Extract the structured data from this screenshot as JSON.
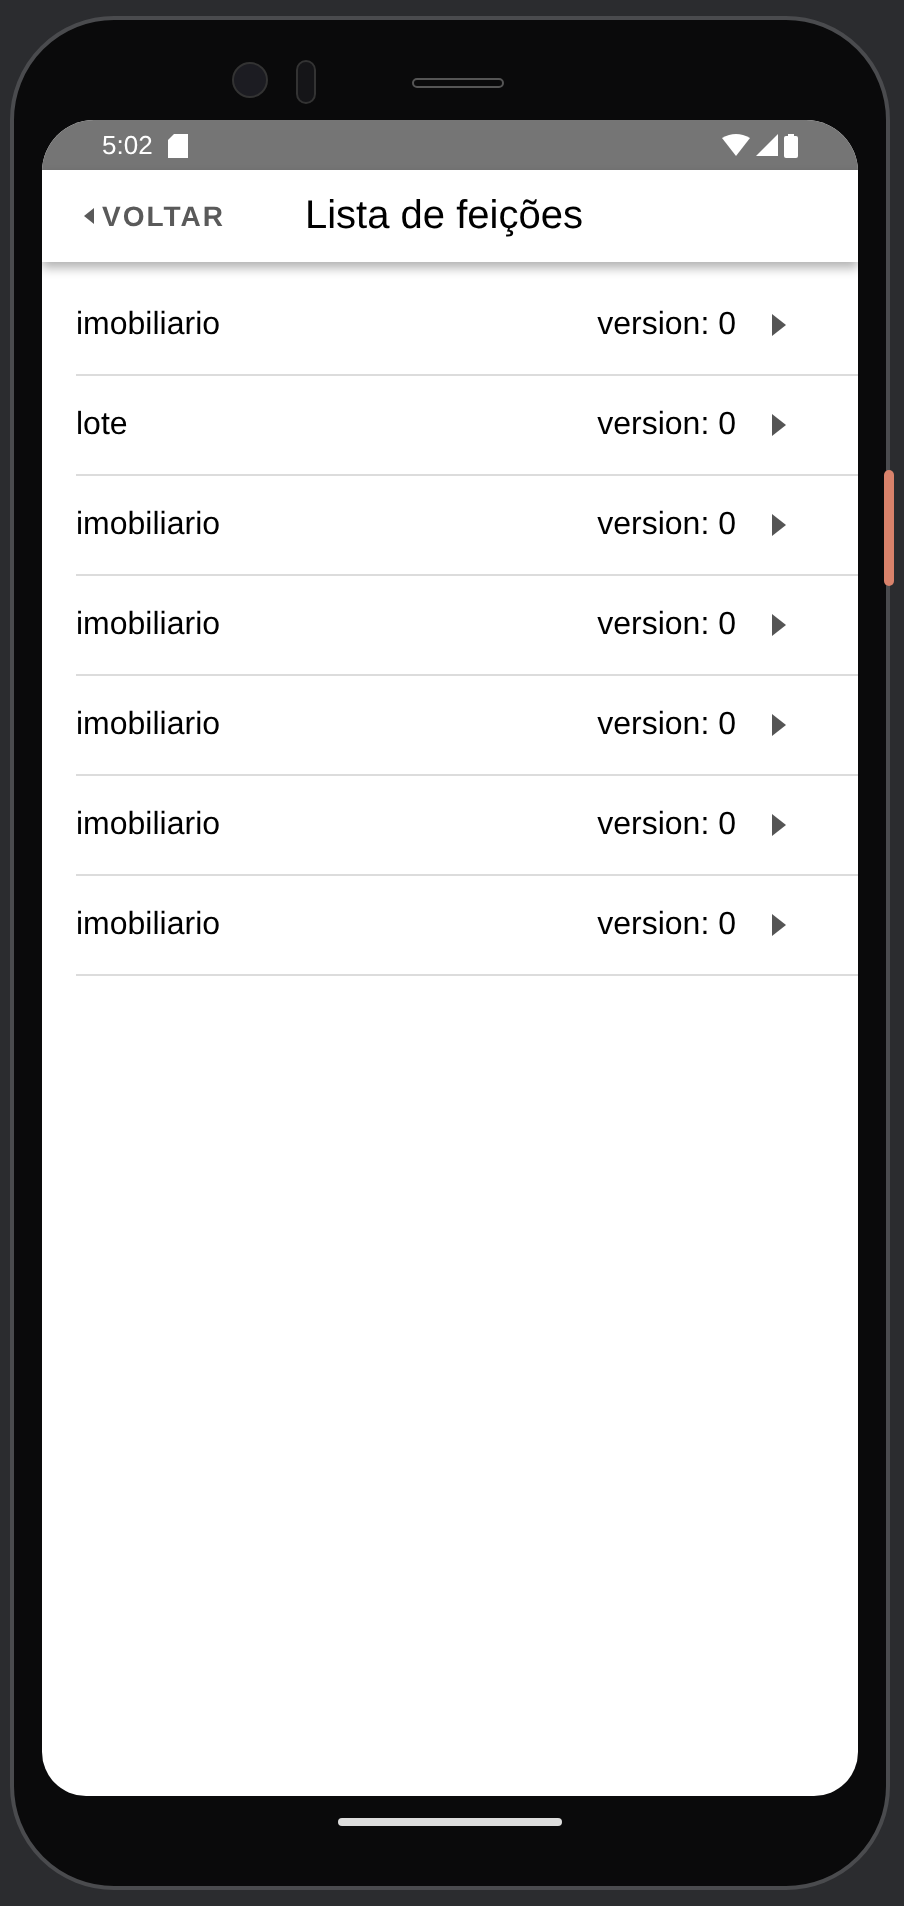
{
  "status_bar": {
    "time": "5:02"
  },
  "header": {
    "back": "VOLTAR",
    "title": "Lista de feições"
  },
  "items": [
    {
      "name": "imobiliario",
      "version": "version: 0"
    },
    {
      "name": "lote",
      "version": "version: 0"
    },
    {
      "name": "imobiliario",
      "version": "version: 0"
    },
    {
      "name": "imobiliario",
      "version": "version: 0"
    },
    {
      "name": "imobiliario",
      "version": "version: 0"
    },
    {
      "name": "imobiliario",
      "version": "version: 0"
    },
    {
      "name": "imobiliario",
      "version": "version: 0"
    }
  ]
}
